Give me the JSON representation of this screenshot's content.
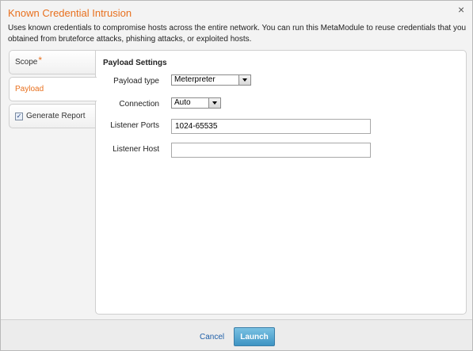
{
  "dialog": {
    "title": "Known Credential Intrusion",
    "close_symbol": "×",
    "description": "Uses known credentials to compromise hosts across the entire network. You can run this MetaModule to reuse credentials that you obtained from bruteforce attacks, phishing attacks, or exploited hosts."
  },
  "tabs": {
    "scope": {
      "label": "Scope",
      "required_mark": "*"
    },
    "payload": {
      "label": "Payload"
    },
    "report": {
      "label": "Generate Report",
      "checked": true
    }
  },
  "payload_settings": {
    "heading": "Payload Settings",
    "payload_type": {
      "label": "Payload type",
      "value": "Meterpreter"
    },
    "connection": {
      "label": "Connection",
      "value": "Auto"
    },
    "listener_ports": {
      "label": "Listener Ports",
      "value": "1024-65535"
    },
    "listener_host": {
      "label": "Listener Host",
      "value": ""
    }
  },
  "footer": {
    "cancel_label": "Cancel",
    "launch_label": "Launch"
  },
  "colors": {
    "accent": "#e8701e",
    "link": "#1f5fa8",
    "launch_button": "#3e94c3"
  }
}
